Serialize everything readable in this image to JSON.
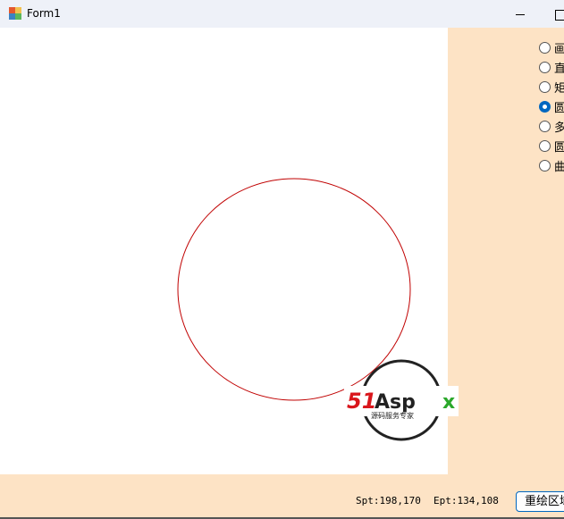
{
  "window": {
    "title": "Form1"
  },
  "shapes": [
    {
      "label": "画",
      "checked": false
    },
    {
      "label": "直",
      "checked": false
    },
    {
      "label": "矩",
      "checked": false
    },
    {
      "label": "圆",
      "checked": true
    },
    {
      "label": "多",
      "checked": false
    },
    {
      "label": "圆",
      "checked": false
    },
    {
      "label": "曲",
      "checked": false
    }
  ],
  "status": {
    "spt": "Spt:198,170",
    "ept": "Ept:134,108"
  },
  "redraw_label": "重绘区域",
  "watermark": {
    "brand": "51Aspx",
    "tagline": "源码服务专家"
  },
  "colors": {
    "circle": "#c00000",
    "panel": "#fde3c5",
    "accent": "#0067c0"
  }
}
